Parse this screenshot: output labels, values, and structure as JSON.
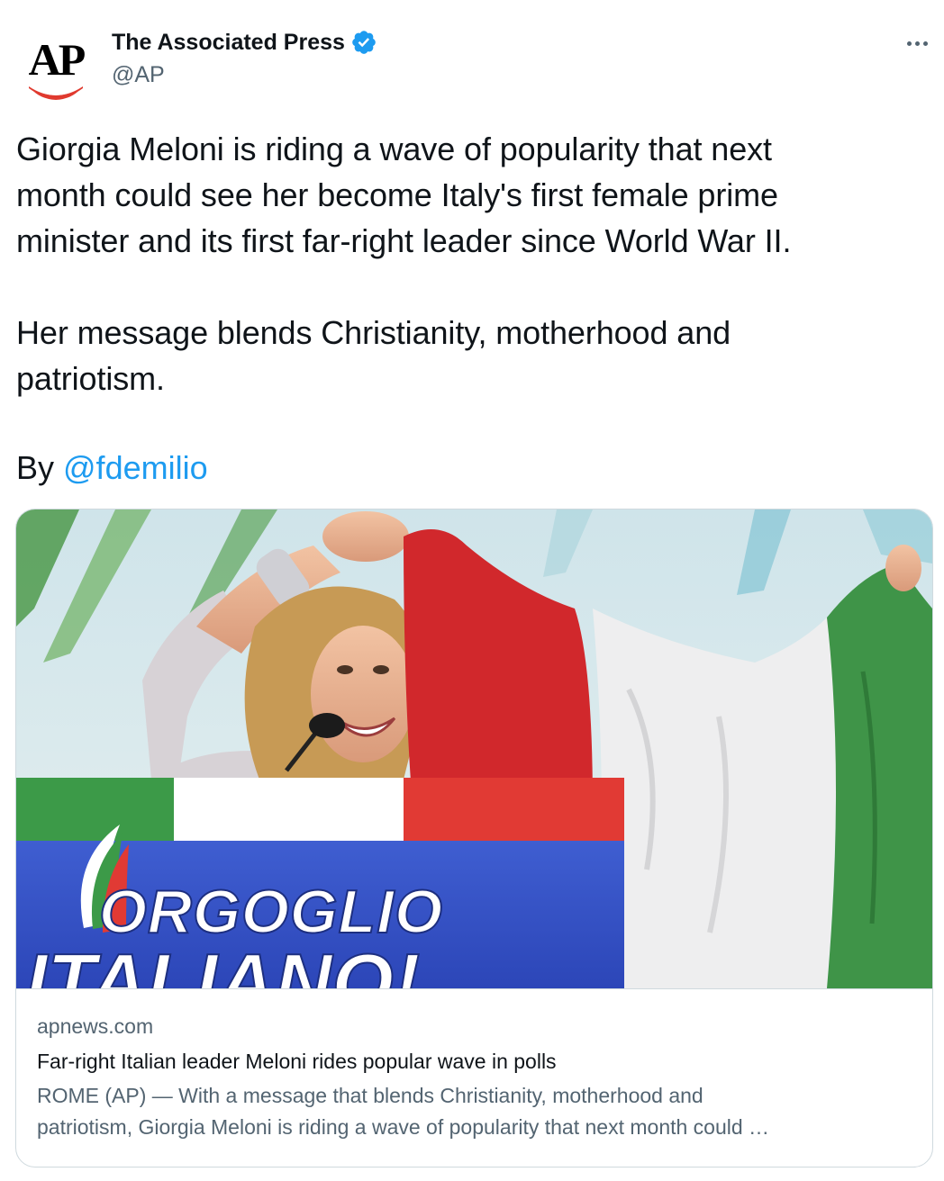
{
  "author": {
    "logo_text": "AP",
    "display_name": "The Associated Press",
    "handle": "@AP",
    "verified_icon": "verified-badge-icon",
    "verified_color": "#1d9bf0"
  },
  "tweet": {
    "text": "Giorgia Meloni is riding a wave of popularity that next\nmonth could see her become Italy's first female prime\nminister and its first far-right leader since World War II.\n\nHer message blends Christianity, motherhood and\npatriotism.",
    "byline_prefix": "By ",
    "mention": "@fdemilio"
  },
  "card": {
    "image_sign_line1": "ORGOGLIO",
    "image_sign_line2": "ITALIANO!",
    "domain": "apnews.com",
    "title": "Far-right Italian leader Meloni rides popular wave in polls",
    "description": "ROME (AP) — With a message that blends Christianity, motherhood and\npatriotism, Giorgia Meloni is riding a wave of popularity that next month could …"
  },
  "colors": {
    "accent": "#1d9bf0",
    "text": "#0f1419",
    "secondary": "#536471",
    "border": "#cfd9de",
    "ap_red": "#e03a2f"
  }
}
